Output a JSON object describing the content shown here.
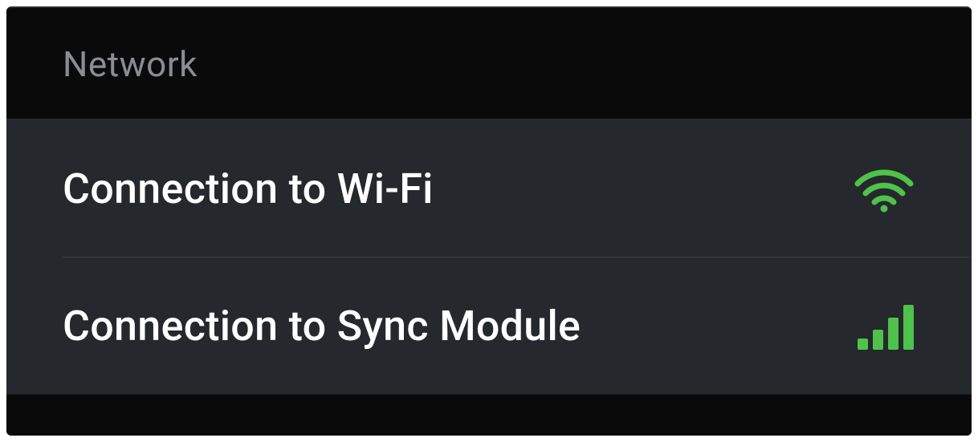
{
  "section": {
    "title": "Network",
    "items": [
      {
        "label": "Connection to Wi-Fi",
        "icon": "wifi-icon",
        "status_color": "#4fc24b"
      },
      {
        "label": "Connection to Sync Module",
        "icon": "signal-bars-icon",
        "status_color": "#4fc24b"
      }
    ]
  }
}
